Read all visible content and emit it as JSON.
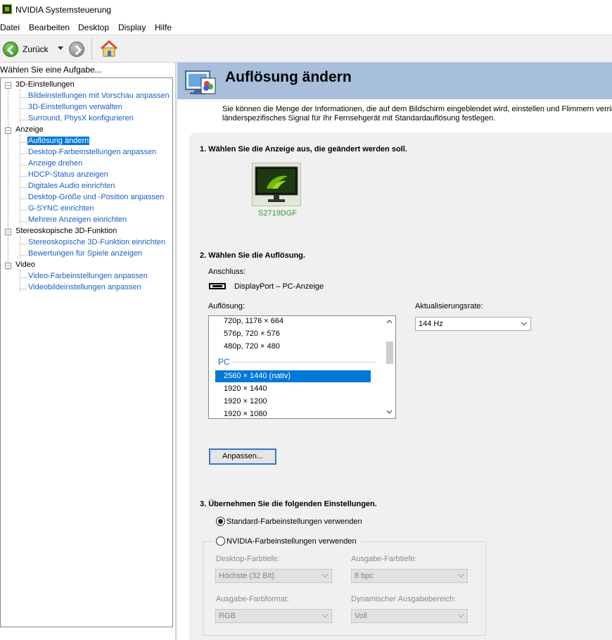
{
  "window": {
    "title": "NVIDIA Systemsteuerung"
  },
  "menu": [
    "Datei",
    "Bearbeiten",
    "Desktop",
    "Display",
    "Hilfe"
  ],
  "toolbar": {
    "back_label": "Zurück"
  },
  "sidebar": {
    "header": "Wählen Sie eine Aufgabe...",
    "categories": [
      {
        "label": "3D-Einstellungen",
        "items": [
          "Bildeinstellungen mit Vorschau anpassen",
          "3D-Einstellungen verwalten",
          "Surround, PhysX konfigurieren"
        ]
      },
      {
        "label": "Anzeige",
        "items": [
          "Auflösung ändern",
          "Desktop-Farbeinstellungen anpassen",
          "Anzeige drehen",
          "HDCP-Status anzeigen",
          "Digitales Audio einrichten",
          "Desktop-Größe und -Position anpassen",
          "G-SYNC einrichten",
          "Mehrere Anzeigen einrichten"
        ]
      },
      {
        "label": "Stereoskopische 3D-Funktion",
        "items": [
          "Stereoskopische 3D-Funktion einrichten",
          "Bewertungen für Spiele anzeigen"
        ]
      },
      {
        "label": "Video",
        "items": [
          "Video-Farbeinstellungen anpassen",
          "Videobildeinstellungen anpassen"
        ]
      }
    ],
    "selected": "Auflösung ändern"
  },
  "page": {
    "title": "Auflösung ändern",
    "description_line1": "Sie können die Menge der Informationen, die auf dem Bildschirm eingeblendet wird, einstellen und Flimmern verringern",
    "description_line2": "länderspezifisches Signal für Ihr Fernsehgerät mit Standardauflösung festlegen."
  },
  "step1": {
    "title": "1. Wählen Sie die Anzeige aus, die geändert werden soll.",
    "display_name": "S2719DGF"
  },
  "step2": {
    "title": "2. Wählen Sie die Auflösung.",
    "connection_label": "Anschluss:",
    "connection_value": "DisplayPort – PC-Anzeige",
    "resolution_label": "Auflösung:",
    "refresh_label": "Aktualisierungsrate:",
    "refresh_value": "144 Hz",
    "resolutions_top": [
      "720p, 1176 × 664",
      "576p, 720 × 576",
      "480p, 720 × 480"
    ],
    "group_label": "PC",
    "resolutions_pc": [
      "2560 × 1440 (nativ)",
      "1920 × 1440",
      "1920 × 1200",
      "1920 × 1080"
    ],
    "selected_resolution": "2560 × 1440 (nativ)",
    "customize_button": "Anpassen..."
  },
  "step3": {
    "title": "3. Übernehmen Sie die folgenden Einstellungen.",
    "radio_default": "Standard-Farbeinstellungen verwenden",
    "radio_nvidia": "NVIDIA-Farbeinstellungen verwenden",
    "desktop_depth_label": "Desktop-Farbtiefe:",
    "desktop_depth_value": "Höchste (32 Bit)",
    "output_depth_label": "Ausgabe-Farbtiefe:",
    "output_depth_value": "8 bpc",
    "output_format_label": "Ausgabe-Farbformat:",
    "output_format_value": "RGB",
    "dynamic_range_label": "Dynamischer Ausgabebereich:",
    "dynamic_range_value": "Voll"
  },
  "colors": {
    "accent": "#0078d7",
    "header_band": "#a7bfda",
    "link": "#1a5ec1",
    "nvidia_green": "#76b900"
  }
}
